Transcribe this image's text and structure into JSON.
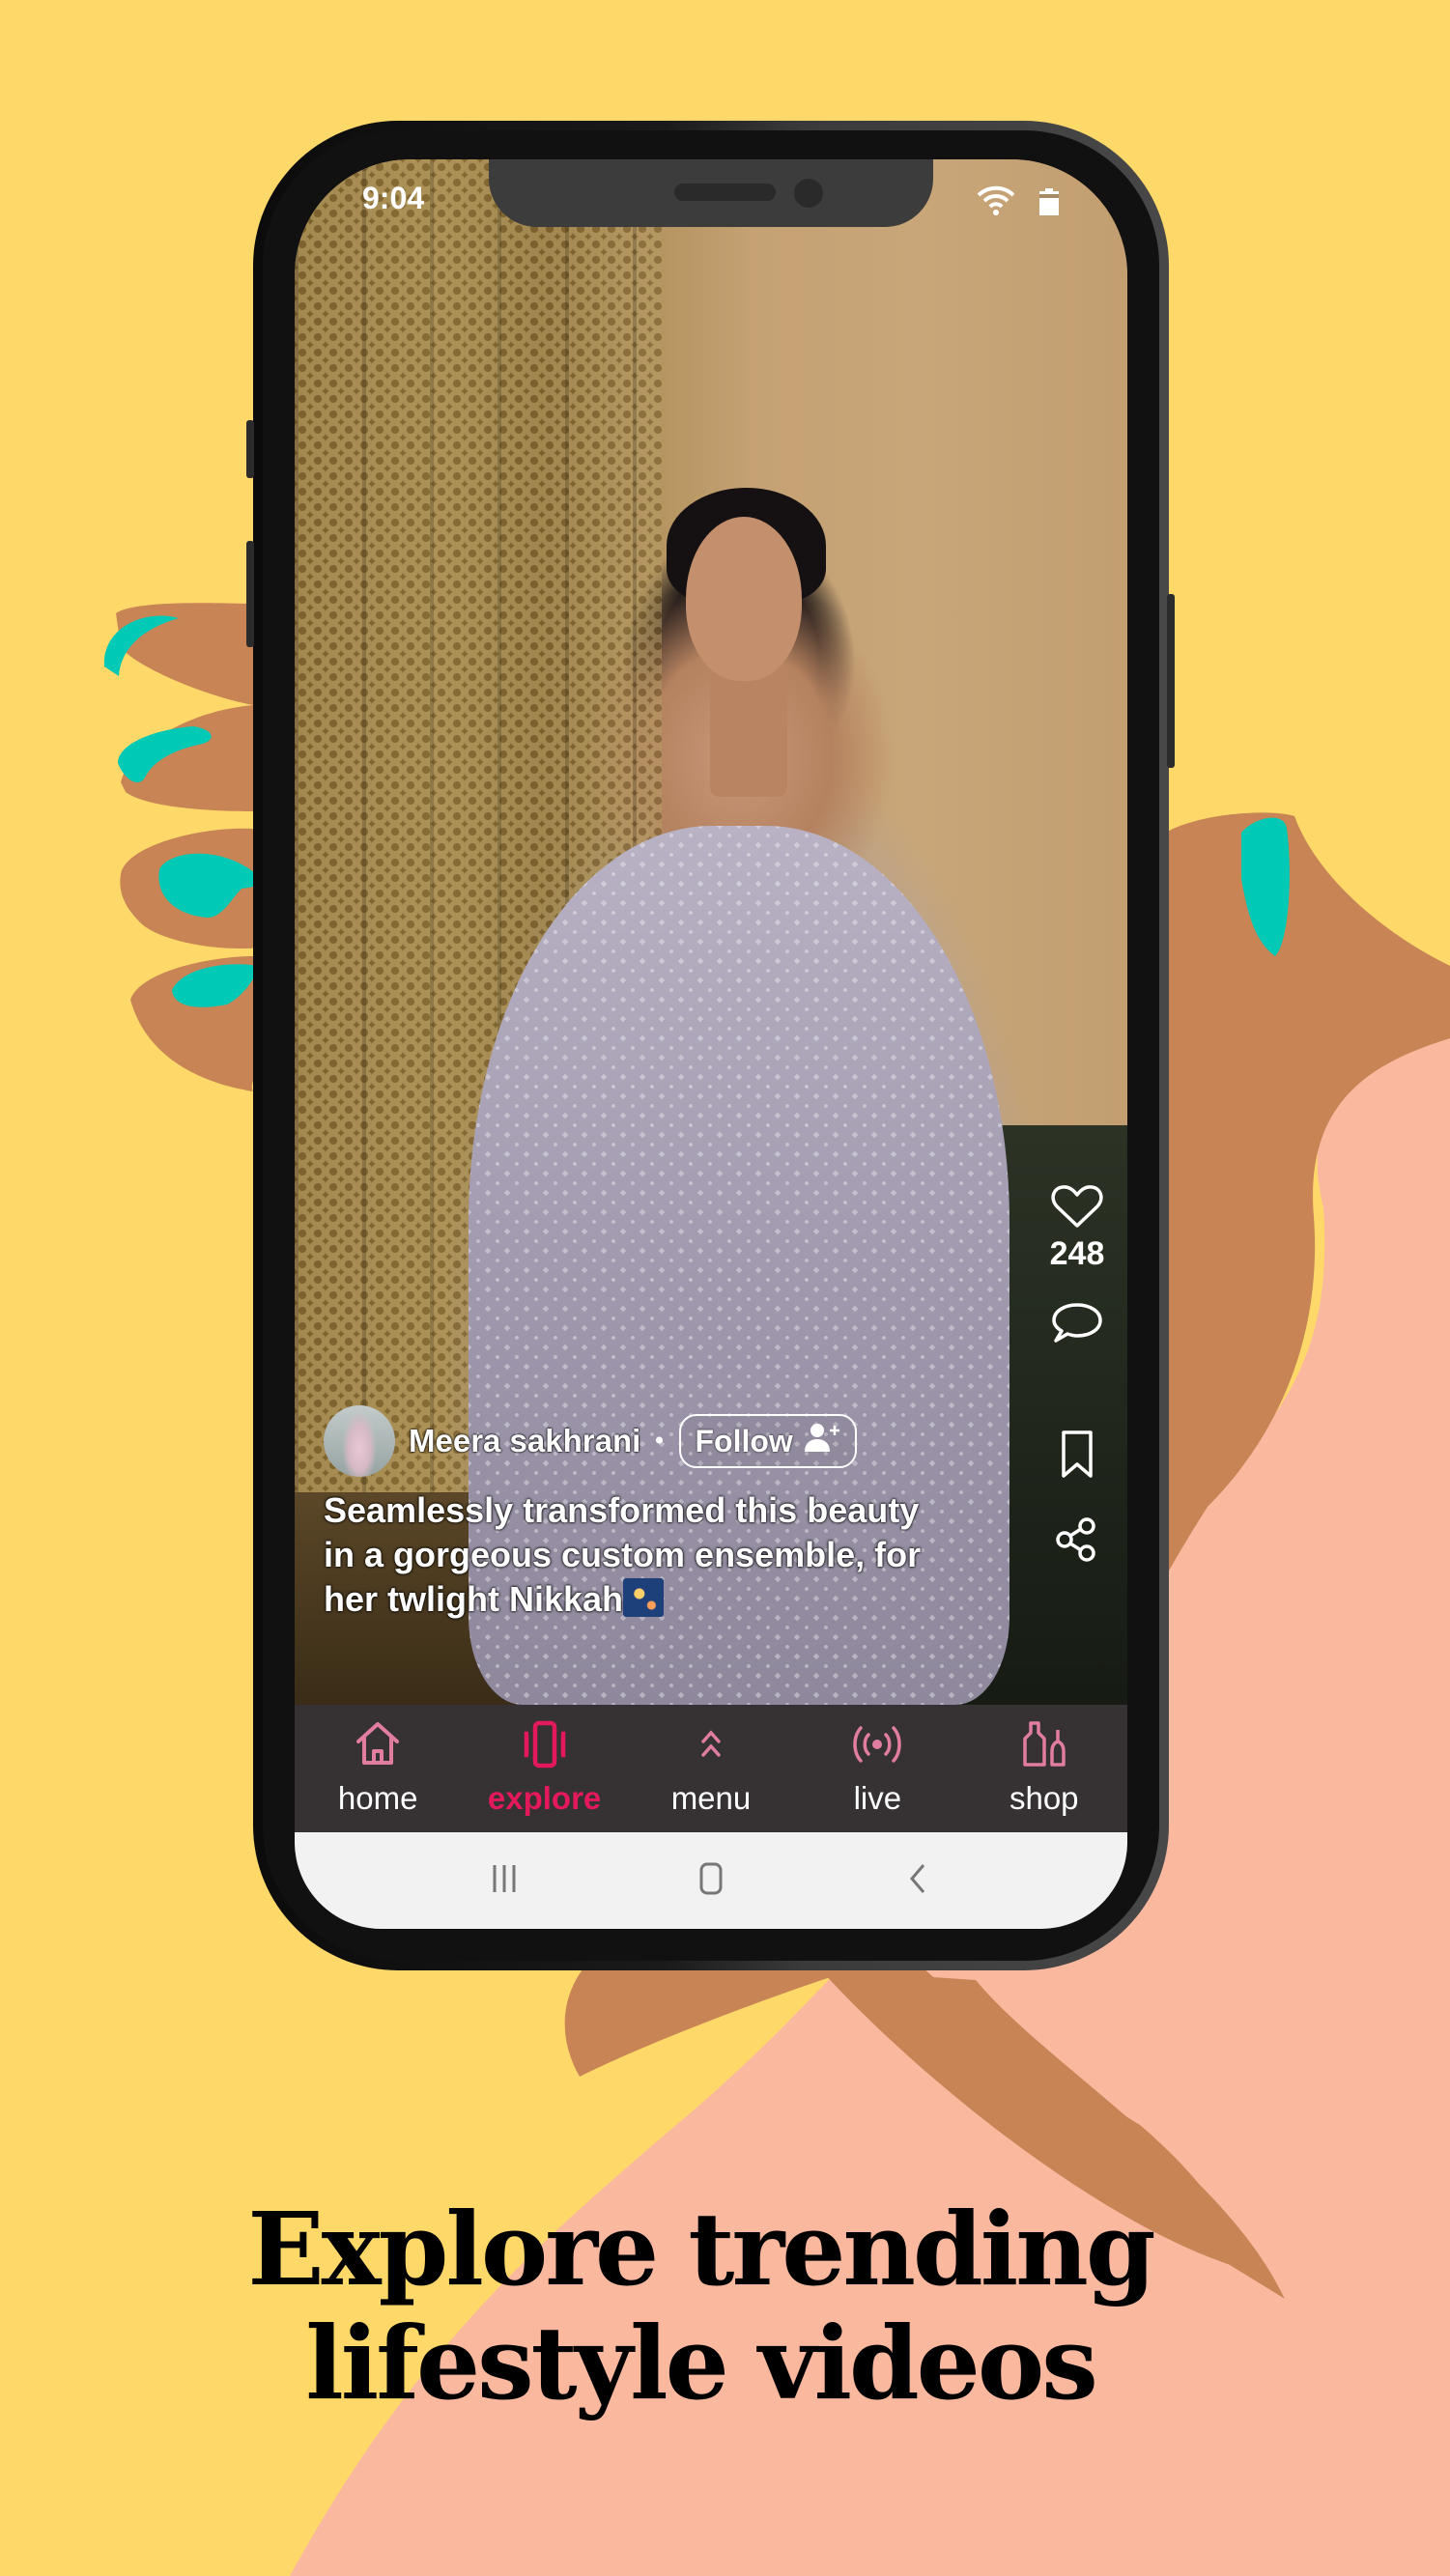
{
  "colors": {
    "background": "#FED96A",
    "skin": "#C88455",
    "nail": "#00C9B5",
    "sleeve": "#FAB89F",
    "accent": "#E3195C",
    "nav_icon": "#E07DA1",
    "nav_bg": "#363132"
  },
  "status_bar": {
    "time": "9:04",
    "icons": [
      "wifi-icon",
      "battery-icon"
    ]
  },
  "post": {
    "author": "Meera sakhrani",
    "separator": "•",
    "follow_label": "Follow",
    "caption": "Seamlessly transformed this beauty in a gorgeous custom ensemble, for her twlight Nikkah",
    "caption_emoji": "fireworks-emoji"
  },
  "actions": {
    "likes": "248",
    "items": [
      "heart-icon",
      "comment-icon",
      "bookmark-icon",
      "share-icon"
    ]
  },
  "bottom_nav": {
    "items": [
      {
        "label": "home",
        "icon": "home-icon",
        "active": false
      },
      {
        "label": "explore",
        "icon": "explore-icon",
        "active": true
      },
      {
        "label": "menu",
        "icon": "chevron-double-up-icon",
        "active": false
      },
      {
        "label": "live",
        "icon": "live-broadcast-icon",
        "active": false
      },
      {
        "label": "shop",
        "icon": "shop-bottles-icon",
        "active": false
      }
    ]
  },
  "system_nav": [
    "recents-icon",
    "home-circle-icon",
    "back-icon"
  ],
  "headline": {
    "line1": "Explore trending",
    "line2": "lifestyle videos"
  }
}
